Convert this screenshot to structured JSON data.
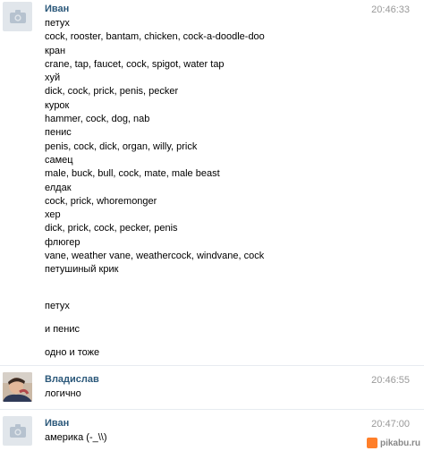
{
  "messages": [
    {
      "author": "Иван",
      "time": "20:46:33",
      "lines": [
        "петух",
        "cock, rooster, bantam, chicken, cock-a-doodle-doo",
        "кран",
        "crane, tap, faucet, cock, spigot, water tap",
        "хуй",
        "dick, cock, prick, penis, pecker",
        "курок",
        "hammer, cock, dog, nab",
        "пенис",
        "penis, cock, dick, organ, willy, prick",
        "самец",
        "male, buck, bull, cock, mate, male beast",
        "елдак",
        "cock, prick, whoremonger",
        "хер",
        "dick, prick, cock, pecker, penis",
        "флюгер",
        "vane, weather vane, weathercock, windvane, cock",
        "петушиный крик"
      ],
      "extra": [
        "петух",
        "и пенис",
        "одно и тоже"
      ]
    },
    {
      "author": "Владислав",
      "time": "20:46:55",
      "lines": [
        "логично"
      ]
    },
    {
      "author": "Иван",
      "time": "20:47:00",
      "lines": [
        "америка (-_\\\\)"
      ]
    }
  ],
  "watermark": "pikabu.ru",
  "colors": {
    "author": "#2b587a",
    "time": "#999999",
    "avatar_placeholder": "#e1e6eb"
  }
}
